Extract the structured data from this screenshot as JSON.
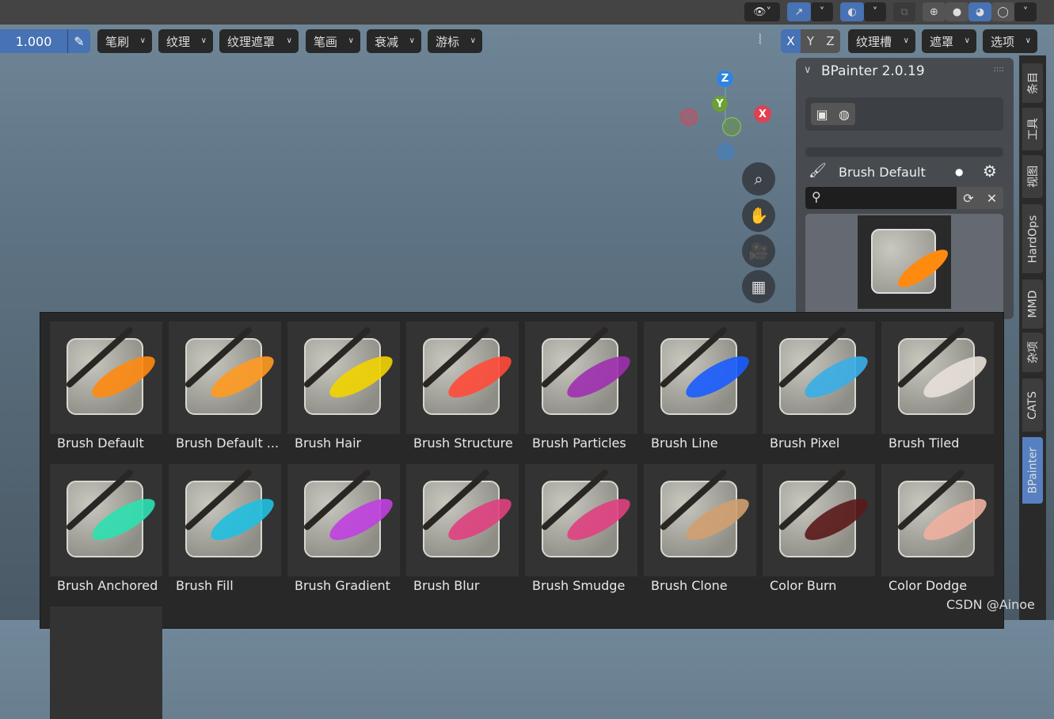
{
  "header": {
    "strength_value": "1.000",
    "menus": [
      "笔刷",
      "纹理",
      "纹理遮罩",
      "笔画",
      "衰减",
      "游标"
    ],
    "axis_buttons": [
      "X",
      "Y",
      "Z"
    ],
    "active_axis": "X",
    "right_menus": [
      "纹理槽",
      "遮罩",
      "选项"
    ]
  },
  "gizmo": {
    "z": "Z",
    "y": "Y",
    "x": "X"
  },
  "panel": {
    "title": "BPainter 2.0.19",
    "brush_name": "Brush Default",
    "search_placeholder": ""
  },
  "sidebar_tabs": [
    "条目",
    "工具",
    "视图",
    "HardOps",
    "MMD",
    "杂项",
    "CATS",
    "BPainter"
  ],
  "active_tab": "BPainter",
  "brushes": [
    {
      "name": "Brush Default",
      "color": "#ff8a10"
    },
    {
      "name": "Brush Default ...",
      "color": "#ff9a20"
    },
    {
      "name": "Brush Hair",
      "color": "#f2d400"
    },
    {
      "name": "Brush Structure",
      "color": "#ff4a3a"
    },
    {
      "name": "Brush Particles",
      "color": "#a030b0"
    },
    {
      "name": "Brush Line",
      "color": "#1a5cff"
    },
    {
      "name": "Brush Pixel",
      "color": "#3aaee8"
    },
    {
      "name": "Brush Tiled",
      "color": "#e8e0d8"
    },
    {
      "name": "Brush Anchored",
      "color": "#2ee0b0"
    },
    {
      "name": "Brush Fill",
      "color": "#20c0e0"
    },
    {
      "name": "Brush Gradient",
      "color": "#c040e0"
    },
    {
      "name": "Brush Blur",
      "color": "#e04080"
    },
    {
      "name": "Brush Smudge",
      "color": "#e04080"
    },
    {
      "name": "Brush Clone",
      "color": "#d0a070"
    },
    {
      "name": "Color Burn",
      "color": "#5a1a1a"
    },
    {
      "name": "Color Dodge",
      "color": "#f0b0a0"
    }
  ],
  "watermark": "CSDN @Ainoe"
}
